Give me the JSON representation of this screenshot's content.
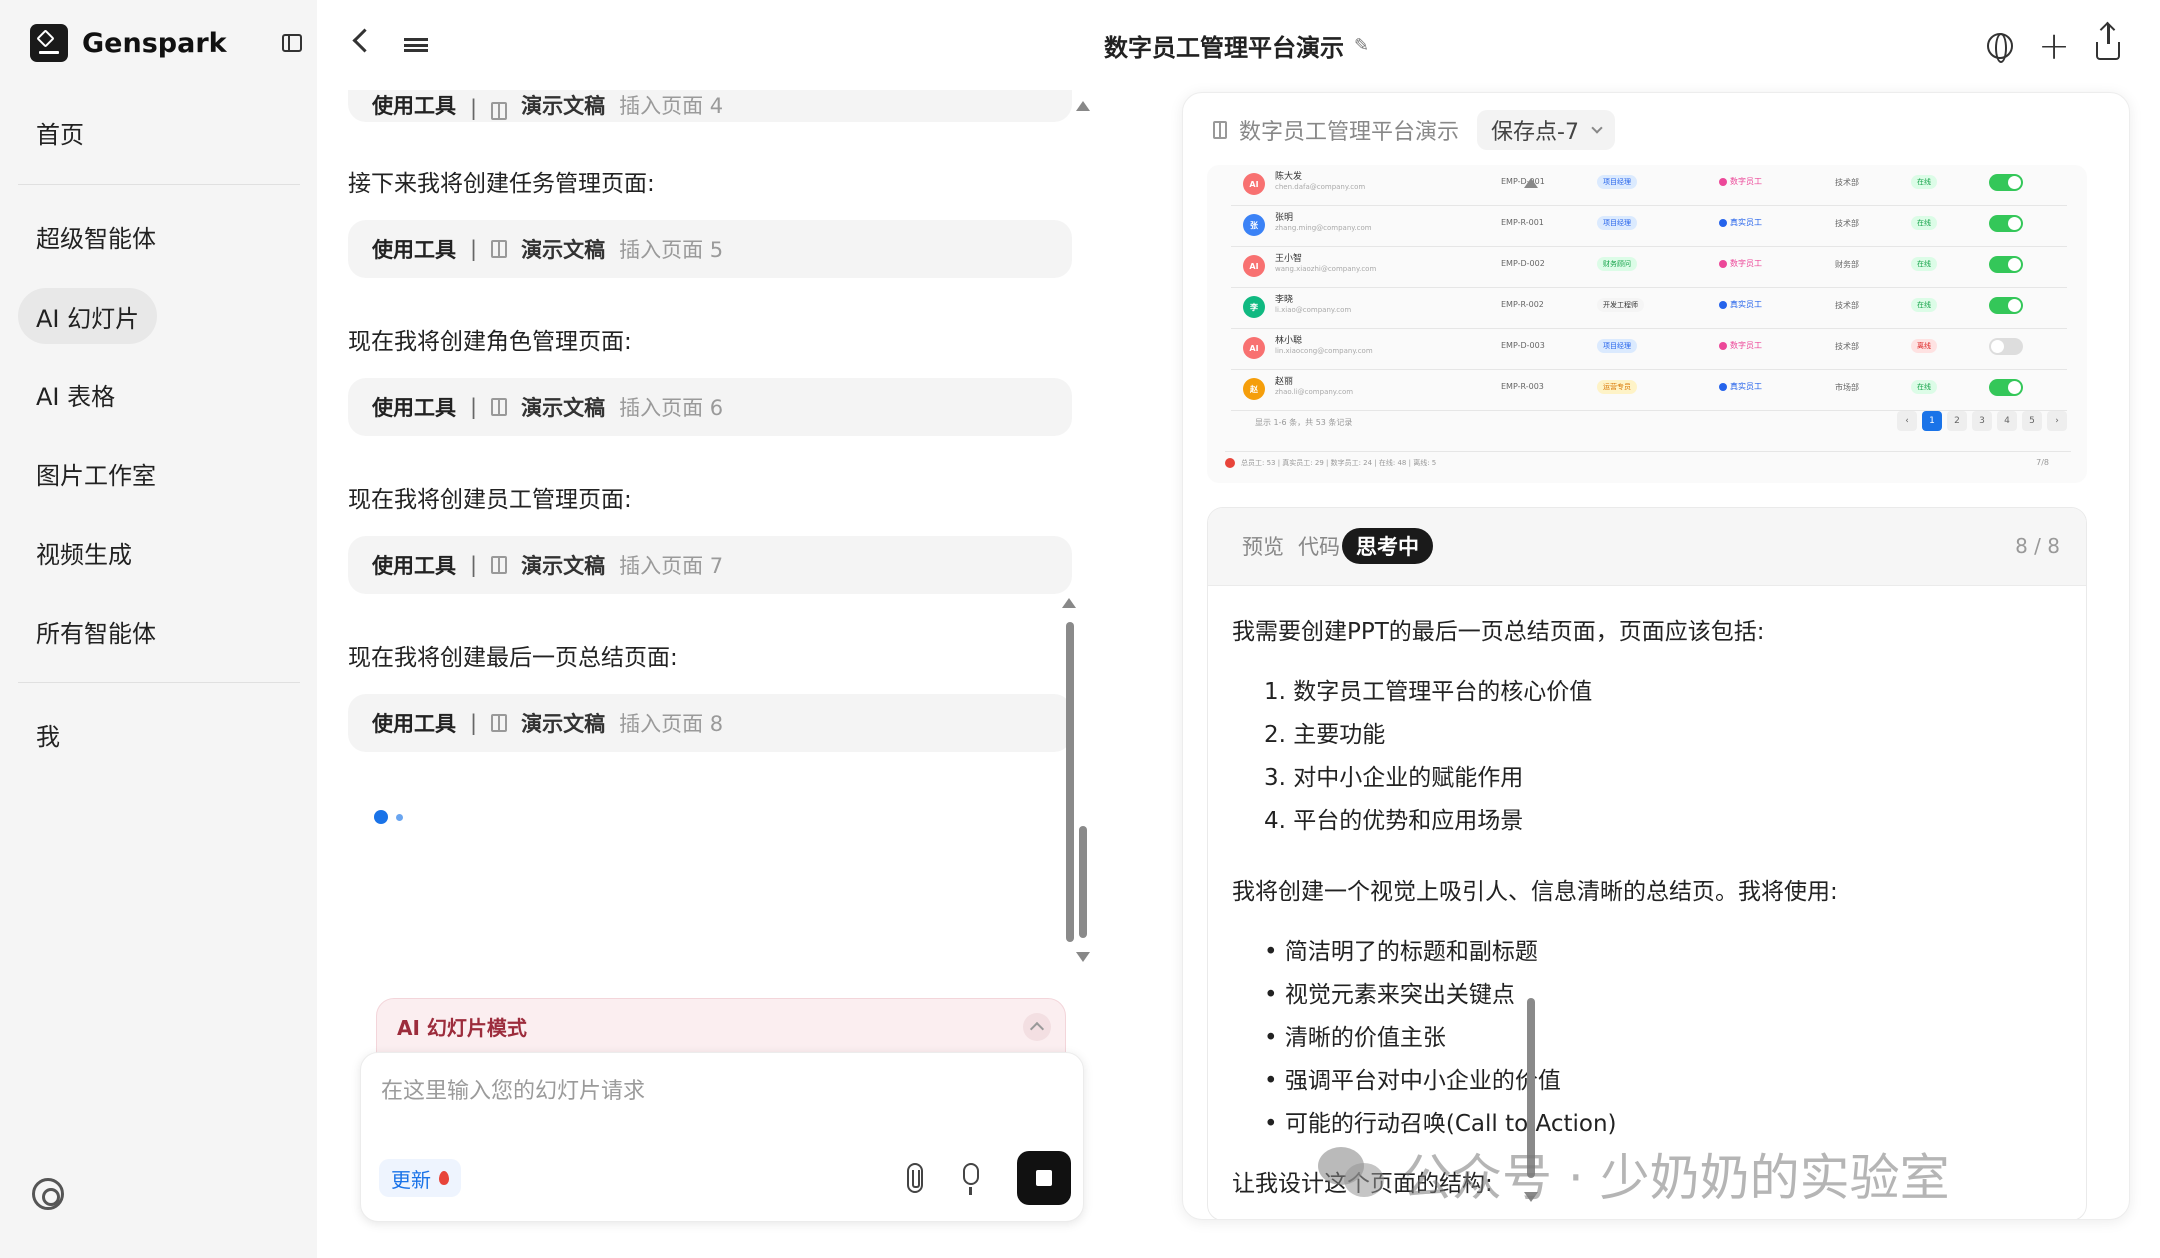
{
  "app": {
    "name": "Genspark"
  },
  "sidebar": {
    "items": [
      {
        "label": "首页"
      },
      {
        "label": "超级智能体"
      },
      {
        "label": "AI 幻灯片",
        "active": true
      },
      {
        "label": "AI 表格"
      },
      {
        "label": "图片工作室"
      },
      {
        "label": "视频生成"
      },
      {
        "label": "所有智能体"
      },
      {
        "label": "我"
      }
    ]
  },
  "header": {
    "title": "数字员工管理平台演示"
  },
  "chat": {
    "partial_card": {
      "tool_label": "使用工具",
      "separator": "|",
      "tool_name": "演示文稿",
      "action": "插入页面 4"
    },
    "messages": [
      {
        "text": "接下来我将创建任务管理页面:",
        "tool_label": "使用工具",
        "separator": "|",
        "tool_name": "演示文稿",
        "action": "插入页面 5"
      },
      {
        "text": "现在我将创建角色管理页面:",
        "tool_label": "使用工具",
        "separator": "|",
        "tool_name": "演示文稿",
        "action": "插入页面 6"
      },
      {
        "text": "现在我将创建员工管理页面:",
        "tool_label": "使用工具",
        "separator": "|",
        "tool_name": "演示文稿",
        "action": "插入页面 7"
      },
      {
        "text": "现在我将创建最后一页总结页面:",
        "tool_label": "使用工具",
        "separator": "|",
        "tool_name": "演示文稿",
        "action": "插入页面 8"
      }
    ]
  },
  "composer": {
    "mode_label": "AI 幻灯片模式",
    "placeholder": "在这里输入您的幻灯片请求",
    "value": "",
    "update_label": "更新"
  },
  "panel": {
    "doc_name": "数字员工管理平台演示",
    "save_point": "保存点-7",
    "slide": {
      "rows": [
        {
          "avatar": "AI",
          "avatar_color": "#f87171",
          "name": "陈大发",
          "email": "chen.dafa@company.com",
          "code": "EMP-D-001",
          "tag": "项目经理",
          "tag_color": "#dbeafe",
          "tag_text": "#2563eb",
          "type": "数字员工",
          "type_color": "#ec4899",
          "dept": "技术部",
          "status": "在线",
          "status_color": "#dcfce7",
          "status_text": "#16a34a",
          "enabled": true
        },
        {
          "avatar": "张",
          "avatar_color": "#3b82f6",
          "name": "张明",
          "email": "zhang.ming@company.com",
          "code": "EMP-R-001",
          "tag": "项目经理",
          "tag_color": "#dbeafe",
          "tag_text": "#2563eb",
          "type": "真实员工",
          "type_color": "#2563eb",
          "dept": "技术部",
          "status": "在线",
          "status_color": "#dcfce7",
          "status_text": "#16a34a",
          "enabled": true
        },
        {
          "avatar": "AI",
          "avatar_color": "#f87171",
          "name": "王小智",
          "email": "wang.xiaozhi@company.com",
          "code": "EMP-D-002",
          "tag": "财务顾问",
          "tag_color": "#dcfce7",
          "tag_text": "#16a34a",
          "type": "数字员工",
          "type_color": "#ec4899",
          "dept": "财务部",
          "status": "在线",
          "status_color": "#dcfce7",
          "status_text": "#16a34a",
          "enabled": true
        },
        {
          "avatar": "李",
          "avatar_color": "#10b981",
          "name": "李晓",
          "email": "li.xiao@company.com",
          "code": "EMP-R-002",
          "tag": "开发工程师",
          "tag_color": "#f5f5f5",
          "tag_text": "#333333",
          "type": "真实员工",
          "type_color": "#2563eb",
          "dept": "技术部",
          "status": "在线",
          "status_color": "#dcfce7",
          "status_text": "#16a34a",
          "enabled": true
        },
        {
          "avatar": "AI",
          "avatar_color": "#f87171",
          "name": "林小聪",
          "email": "lin.xiaocong@company.com",
          "code": "EMP-D-003",
          "tag": "项目经理",
          "tag_color": "#dbeafe",
          "tag_text": "#2563eb",
          "type": "数字员工",
          "type_color": "#ec4899",
          "dept": "技术部",
          "status": "离线",
          "status_color": "#fee2e2",
          "status_text": "#dc2626",
          "enabled": false
        },
        {
          "avatar": "赵",
          "avatar_color": "#f59e0b",
          "name": "赵丽",
          "email": "zhao.li@company.com",
          "code": "EMP-R-003",
          "tag": "运营专员",
          "tag_color": "#fef3c7",
          "tag_text": "#d97706",
          "type": "真实员工",
          "type_color": "#2563eb",
          "dept": "市场部",
          "status": "在线",
          "status_color": "#dcfce7",
          "status_text": "#16a34a",
          "enabled": true
        }
      ],
      "footer": "显示 1-6 条，共 53 条记录",
      "pages": [
        "‹",
        "1",
        "2",
        "3",
        "4",
        "5",
        "›"
      ],
      "current_page": "1",
      "stats": "总员工: 53 | 真实员工: 29 | 数字员工: 24 | 在线: 48 | 离线: 5",
      "page_indicator": "7/8"
    },
    "tabs": [
      {
        "label": "预览"
      },
      {
        "label": "代码"
      },
      {
        "label": "思考中",
        "active": true
      }
    ],
    "count": "8 / 8",
    "thinking": {
      "intro": "我需要创建PPT的最后一页总结页面，页面应该包括:",
      "ordered": [
        "1. 数字员工管理平台的核心价值",
        "2. 主要功能",
        "3. 对中小企业的赋能作用",
        "4. 平台的优势和应用场景"
      ],
      "para": "我将创建一个视觉上吸引人、信息清晰的总结页。我将使用:",
      "bullets": [
        "• 简洁明了的标题和副标题",
        "• 视觉元素来突出关键点",
        "• 清晰的价值主张",
        "• 强调平台对中小企业的价值",
        "• 可能的行动召唤(Call to Action)"
      ],
      "cutoff": "让我设计这个页面的结构:"
    }
  },
  "watermark": "公众号 · 少奶奶的实验室"
}
